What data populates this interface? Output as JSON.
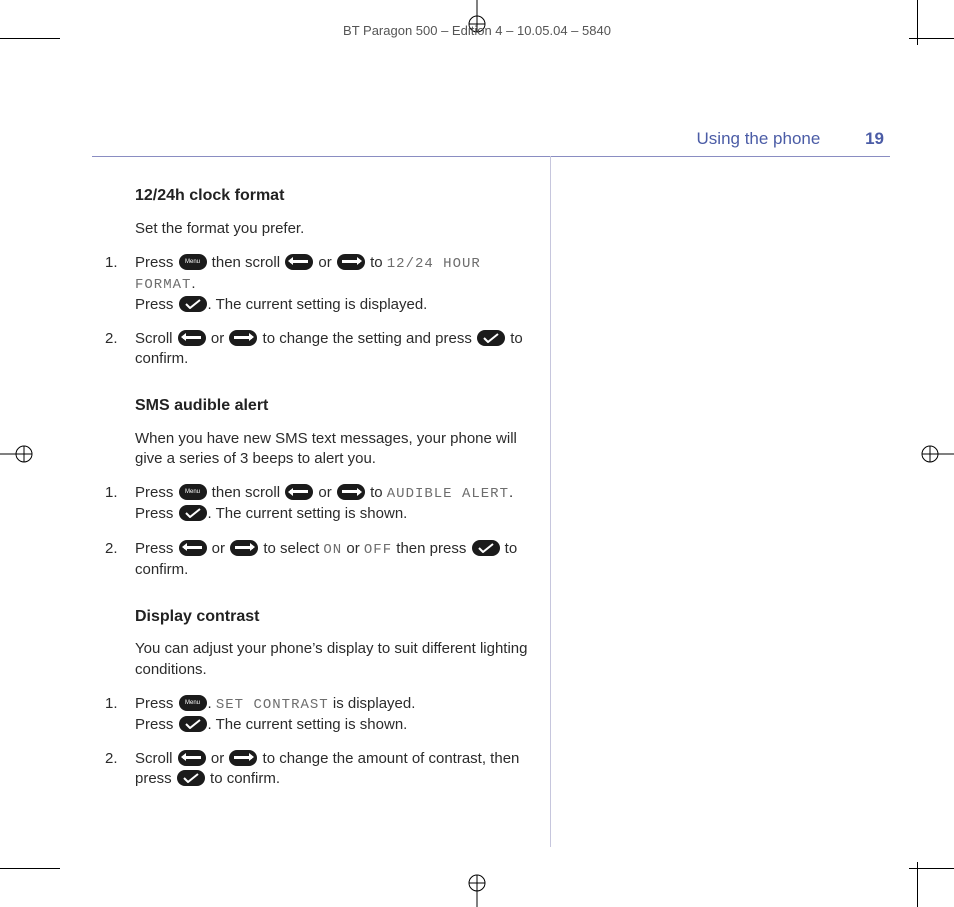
{
  "running_header": "BT Paragon 500 – Edition 4 – 10.05.04 – 5840",
  "section": {
    "title": "Using the phone",
    "page_number": "19"
  },
  "sec1": {
    "heading": "12/24h clock format",
    "intro": "Set the format you prefer.",
    "s1a": "Press ",
    "s1b": " then scroll ",
    "s1c": " or ",
    "s1d": " to ",
    "s1_lcd": "12/24 HOUR FORMAT",
    "s1e": ".",
    "s1f": "Press ",
    "s1g": ". The current setting is displayed.",
    "s2a": "Scroll ",
    "s2b": " or ",
    "s2c": " to change the setting and press ",
    "s2d": " to confirm."
  },
  "sec2": {
    "heading": "SMS audible alert",
    "intro": "When you have new SMS text messages, your phone will give a series of 3 beeps to alert you.",
    "s1a": "Press ",
    "s1b": " then scroll ",
    "s1c": " or ",
    "s1d": " to ",
    "s1_lcd": "AUDIBLE ALERT",
    "s1e": ".",
    "s1f": "Press ",
    "s1g": ". The current setting is shown.",
    "s2a": "Press ",
    "s2b": " or ",
    "s2c": " to select ",
    "s2_lcdOn": "ON",
    "s2d": " or ",
    "s2_lcdOff": "OFF",
    "s2e": " then press ",
    "s2f": " to confirm."
  },
  "sec3": {
    "heading": "Display contrast",
    "intro": "You can adjust your phone’s display to suit different lighting conditions.",
    "s1a": "Press ",
    "s1b": ". ",
    "s1_lcd": "SET CONTRAST",
    "s1c": " is displayed.",
    "s1d": "Press ",
    "s1e": ". The current setting is shown.",
    "s2a": "Scroll ",
    "s2b": " or ",
    "s2c": " to change the amount of contrast, then press ",
    "s2d": " to confirm."
  }
}
